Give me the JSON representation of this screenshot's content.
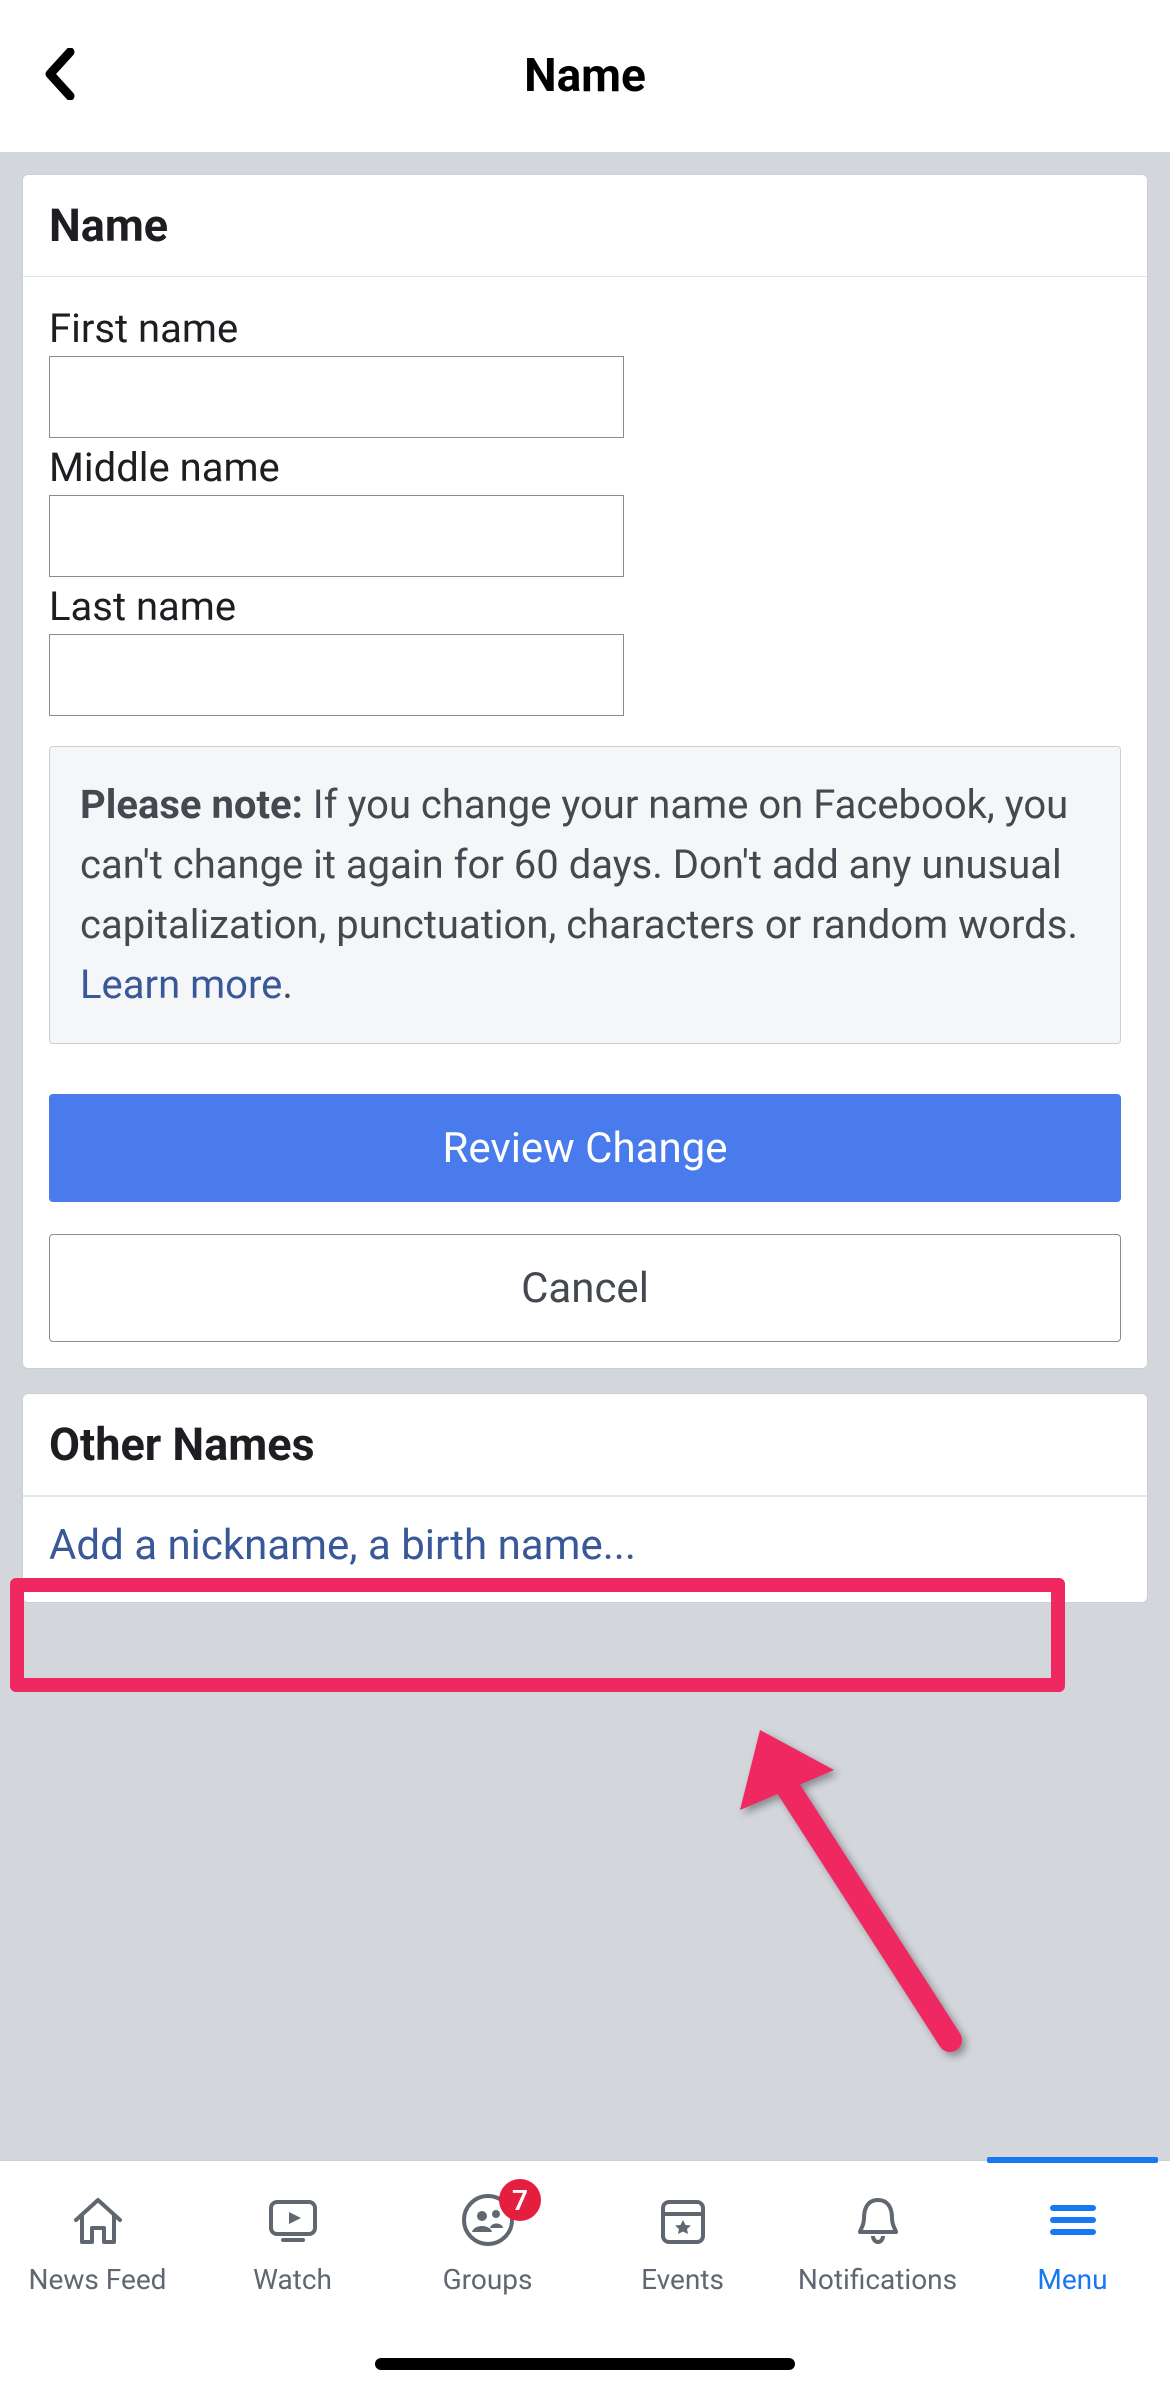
{
  "header": {
    "title": "Name"
  },
  "nameCard": {
    "title": "Name",
    "firstLabel": "First name",
    "firstValue": "",
    "middleLabel": "Middle name",
    "middleValue": "",
    "lastLabel": "Last name",
    "lastValue": "",
    "noteStrong": "Please note:",
    "noteText": " If you change your name on Facebook, you can't change it again for 60 days. Don't add any unusual capitalization, punctuation, characters or random words. ",
    "learnMore": "Learn more",
    "period": ".",
    "reviewButton": "Review Change",
    "cancelButton": "Cancel"
  },
  "otherCard": {
    "title": "Other Names",
    "addLink": "Add a nickname, a birth name..."
  },
  "tabs": {
    "newsFeed": "News Feed",
    "watch": "Watch",
    "groups": "Groups",
    "groupsBadge": "7",
    "events": "Events",
    "notifications": "Notifications",
    "menu": "Menu"
  }
}
